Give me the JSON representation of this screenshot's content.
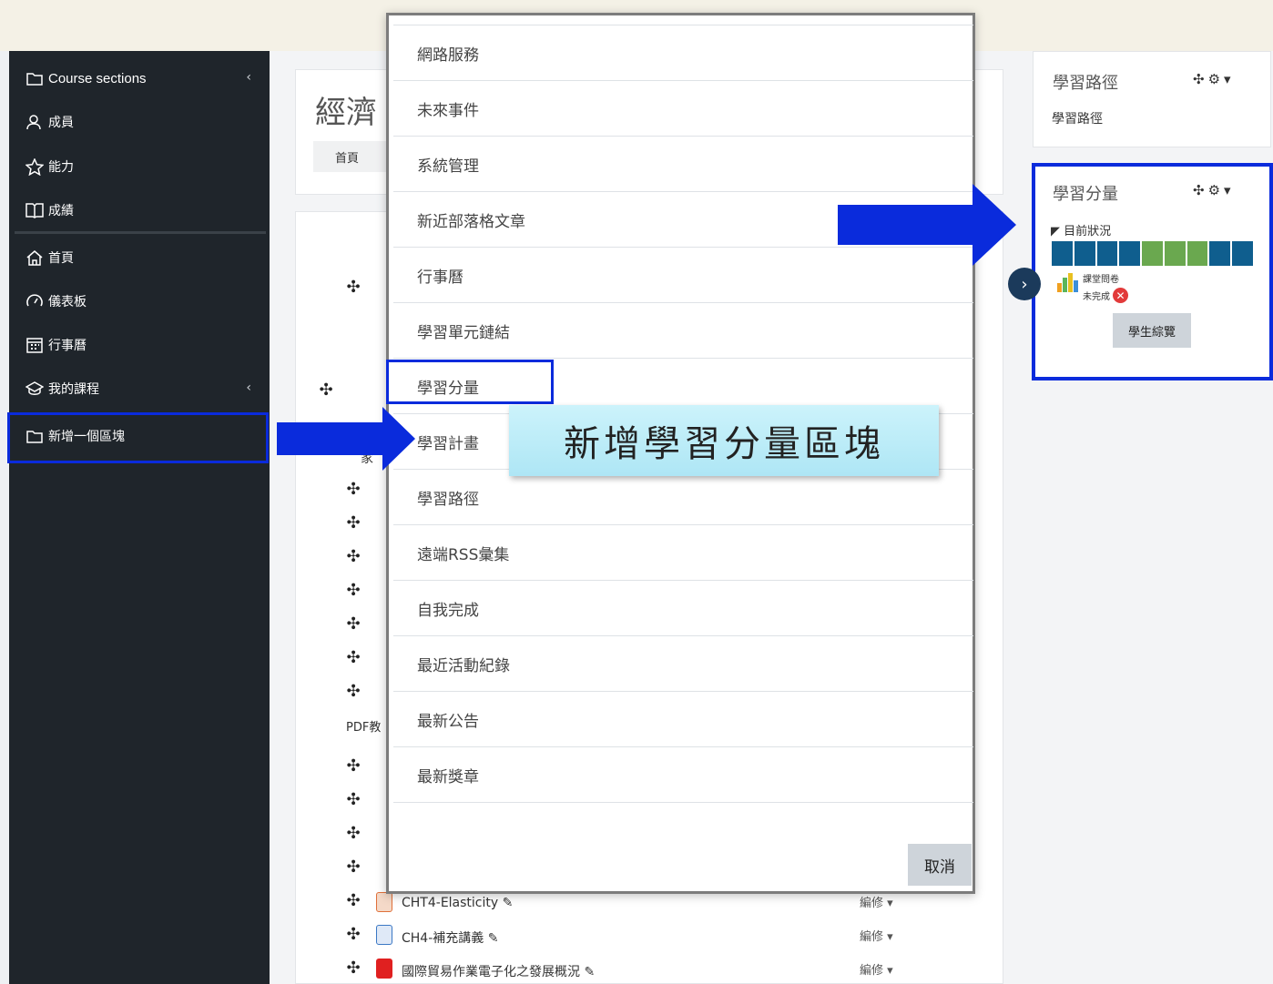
{
  "sidebar": {
    "items": [
      {
        "label": "Course sections",
        "icon": "folder-icon"
      },
      {
        "label": "成員",
        "icon": "user-icon"
      },
      {
        "label": "能力",
        "icon": "star-icon"
      },
      {
        "label": "成績",
        "icon": "book-icon"
      },
      {
        "label": "首頁",
        "icon": "home-icon"
      },
      {
        "label": "儀表板",
        "icon": "dashboard-icon"
      },
      {
        "label": "行事曆",
        "icon": "calendar-icon"
      },
      {
        "label": "我的課程",
        "icon": "graduation-cap-icon"
      },
      {
        "label": "新增一個區塊",
        "icon": "folder-icon"
      }
    ]
  },
  "course": {
    "title": "經濟",
    "breadcrumb_home": "首頁",
    "section_fragment_1": "家",
    "section_fragment_2": "PDF教",
    "activities": [
      {
        "name": "CHT4-Elasticity",
        "edit": "編修"
      },
      {
        "name": "CH4-補充講義",
        "edit": "編修"
      },
      {
        "name": "國際貿易作業電子化之發展概況",
        "edit": "編修"
      }
    ]
  },
  "blocks": {
    "learning_path": {
      "title": "學習路徑",
      "link": "學習路徑"
    },
    "progress": {
      "title": "學習分量",
      "status_label": "目前狀況",
      "item_title": "課堂問卷",
      "item_status": "未完成",
      "overview_button": "學生綜覽",
      "segments": [
        "done",
        "done",
        "done",
        "done",
        "complete",
        "complete",
        "complete",
        "done",
        "done"
      ],
      "colors": {
        "done": "#0f5e8e",
        "complete": "#6aa84f"
      }
    }
  },
  "modal": {
    "items": [
      "網路服務",
      "未來事件",
      "系統管理",
      "新近部落格文章",
      "行事曆",
      "學習單元鏈結",
      "學習分量",
      "學習計畫",
      "學習路徑",
      "遠端RSS彙集",
      "自我完成",
      "最近活動紀錄",
      "最新公告",
      "最新獎章"
    ],
    "cancel": "取消"
  },
  "annotation": {
    "text": "新增學習分量區塊",
    "highlight_color": "#0a2bdc"
  }
}
